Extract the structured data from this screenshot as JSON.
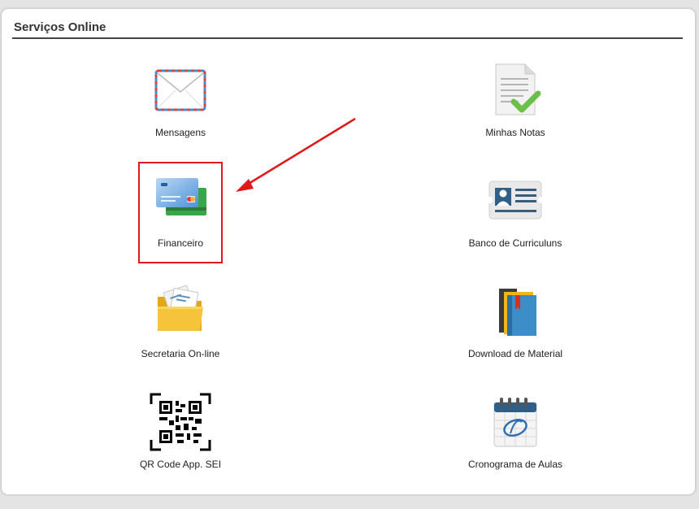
{
  "panel": {
    "title": "Serviços Online"
  },
  "services": [
    {
      "label": "Mensagens",
      "icon": "envelope-icon"
    },
    {
      "label": "Minhas Notas",
      "icon": "document-check-icon"
    },
    {
      "label": "Financeiro",
      "icon": "credit-cards-icon"
    },
    {
      "label": "Banco de Curriculuns",
      "icon": "id-card-icon"
    },
    {
      "label": "Secretaria On-line",
      "icon": "folder-icon"
    },
    {
      "label": "Download de Material",
      "icon": "books-icon"
    },
    {
      "label": "QR Code App. SEI",
      "icon": "qr-code-icon"
    },
    {
      "label": "Cronograma de Aulas",
      "icon": "calendar-icon"
    }
  ],
  "annotation": {
    "highlight_color": "#e01a1a",
    "highlighted_item": "Financeiro"
  }
}
